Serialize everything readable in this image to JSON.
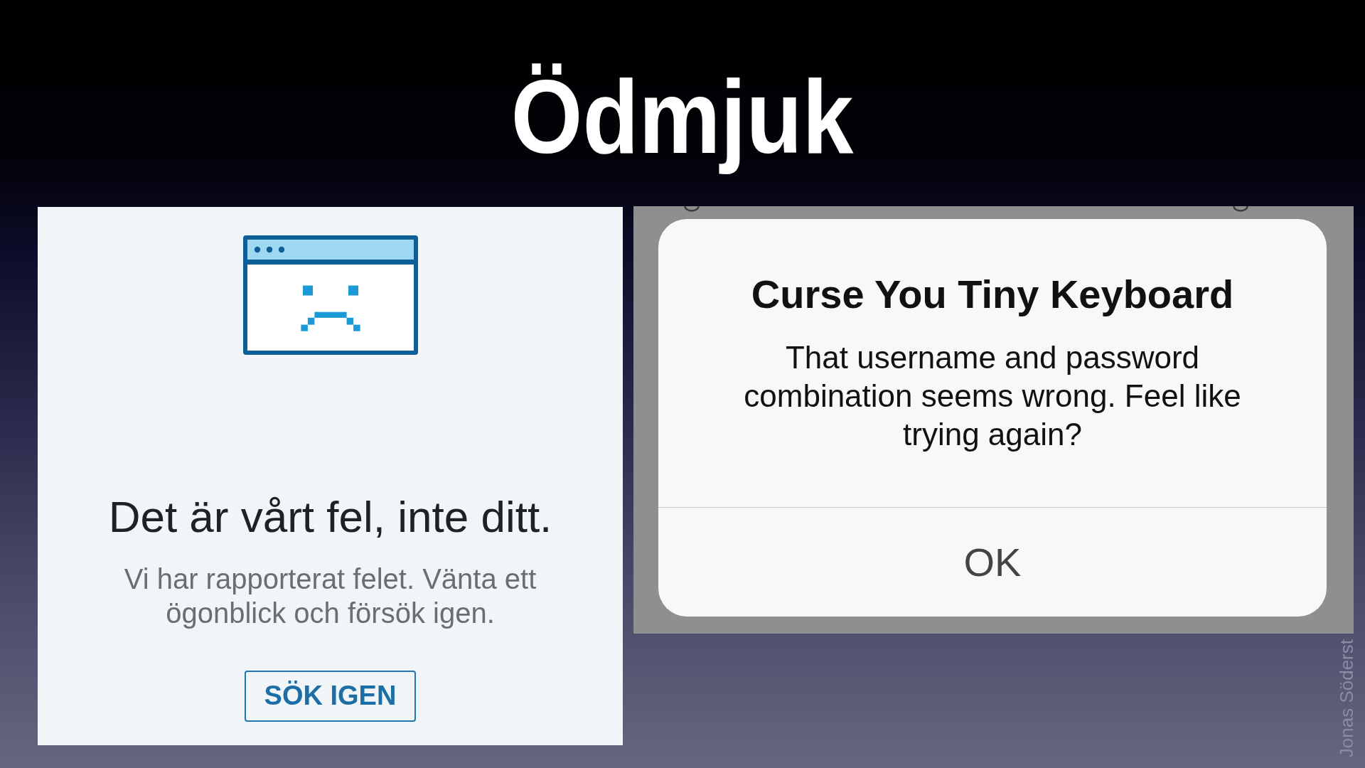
{
  "slide": {
    "title": "Ödmjuk",
    "credit": "Jonas Söderst"
  },
  "error_screen": {
    "heading": "Det är vårt fel, inte ditt.",
    "message": "Vi har rapporterat felet. Vänta ett ögonblick och försök igen.",
    "button": "SÖK IGEN"
  },
  "alert": {
    "title": "Curse You Tiny Keyboard",
    "message": "That username and password combination seems wrong. Feel like trying again?",
    "buttons": [
      "OK"
    ]
  }
}
